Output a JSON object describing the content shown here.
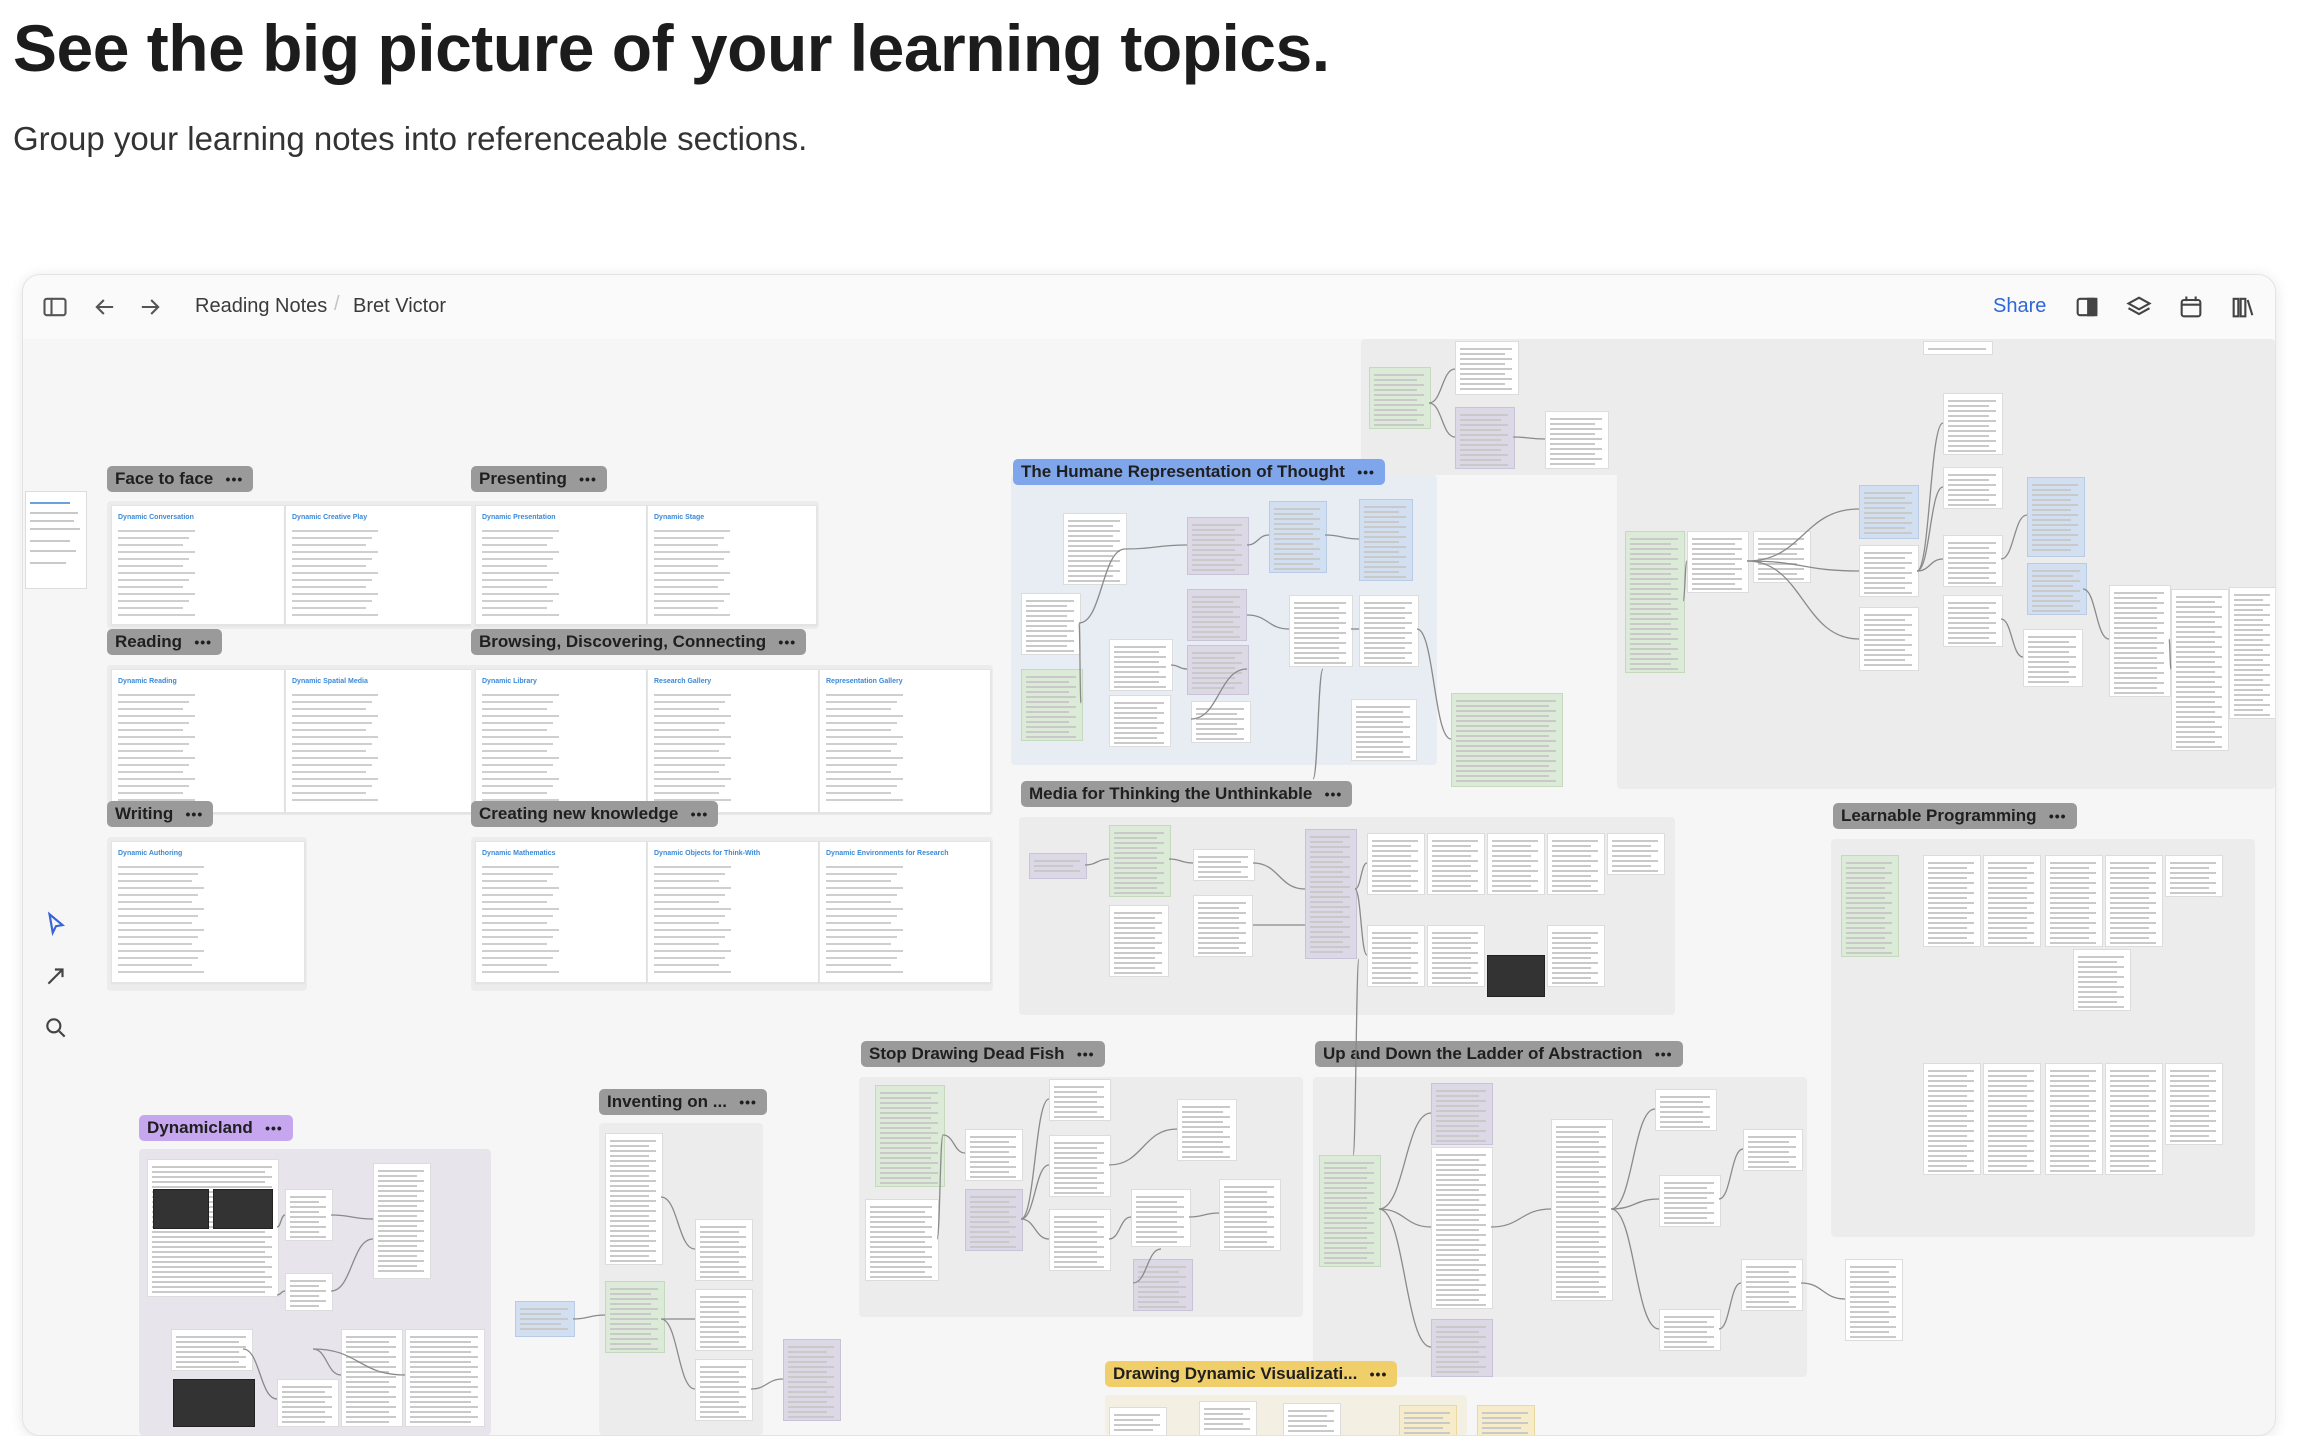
{
  "headline": "See the big picture of your learning topics.",
  "subheadline": "Group your learning notes into referenceable sections.",
  "toolbar": {
    "breadcrumb": [
      "Reading Notes",
      "Bret Victor"
    ],
    "share_label": "Share",
    "icons": [
      "sidebar-toggle-icon",
      "back-arrow-icon",
      "forward-arrow-icon",
      "panel-icon",
      "layers-icon",
      "calendar-icon",
      "library-icon"
    ]
  },
  "tools": [
    "pointer-icon",
    "connector-arrow-icon",
    "zoom-search-icon"
  ],
  "sections": [
    {
      "label": "Face to face",
      "color": "gray"
    },
    {
      "label": "Presenting",
      "color": "gray"
    },
    {
      "label": "Reading",
      "color": "gray"
    },
    {
      "label": "Browsing, Discovering, Connecting",
      "color": "gray"
    },
    {
      "label": "Writing",
      "color": "gray"
    },
    {
      "label": "Creating new knowledge",
      "color": "gray"
    },
    {
      "label": "The Humane Representation of Thought",
      "color": "blue"
    },
    {
      "label": "Media for Thinking the Unthinkable",
      "color": "gray"
    },
    {
      "label": "Learnable Programming",
      "color": "gray"
    },
    {
      "label": "Dynamicland",
      "color": "purple"
    },
    {
      "label": "Inventing on ...",
      "color": "gray"
    },
    {
      "label": "Stop Drawing Dead Fish",
      "color": "gray"
    },
    {
      "label": "Up and Down the Ladder of Abstraction",
      "color": "gray"
    },
    {
      "label": "Drawing Dynamic Visualizati...",
      "color": "yellow"
    }
  ],
  "section_menu": "•••",
  "card_titles": {
    "face": [
      "Dynamic Conversation",
      "Dynamic Creative Play"
    ],
    "presenting": [
      "Dynamic Presentation",
      "Dynamic Stage"
    ],
    "reading": [
      "Dynamic Reading",
      "Dynamic Spatial Media"
    ],
    "browsing": [
      "Dynamic Library",
      "Research Gallery",
      "Representation Gallery"
    ],
    "writing": [
      "Dynamic Authoring"
    ],
    "creating": [
      "Dynamic Mathematics",
      "Dynamic Objects for Think-With",
      "Dynamic Environments for Research"
    ]
  },
  "colors": {
    "accent": "#2d67d8",
    "blue_section": "#7fa6ea",
    "purple_section": "#c6a6ee",
    "yellow_section": "#f0cf6a"
  }
}
